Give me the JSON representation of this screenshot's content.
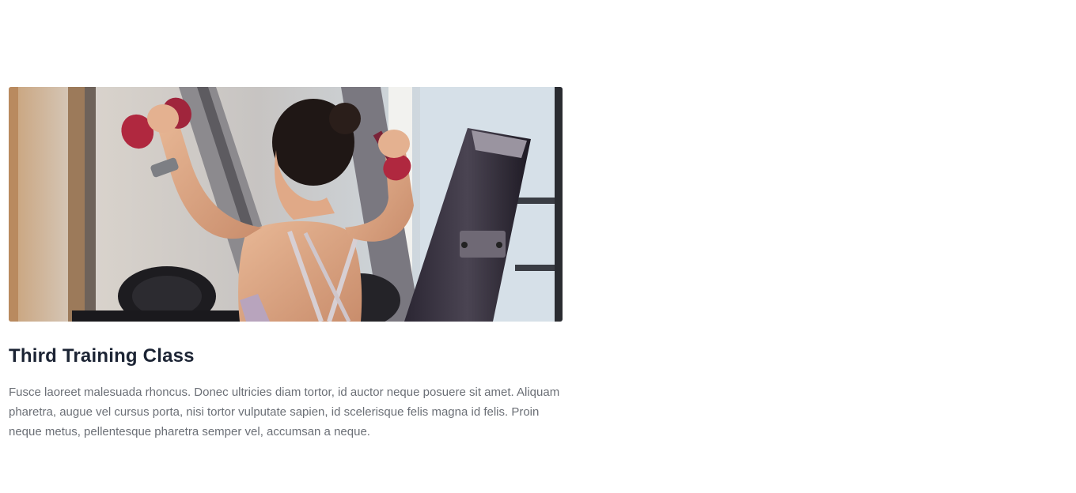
{
  "card": {
    "image_alt": "Woman lifting dumbbells in a gym",
    "title": "Third Training Class",
    "description": "Fusce laoreet malesuada rhoncus. Donec ultricies diam tortor, id auctor neque posuere sit amet. Aliquam pharetra, augue vel cursus porta, nisi tortor vulputate sapien, id scelerisque felis magna id felis. Proin neque metus, pellentesque pharetra semper vel, accumsan a neque."
  },
  "colors": {
    "title": "#1c2434",
    "body_text": "#6b6f76",
    "background": "#ffffff"
  }
}
